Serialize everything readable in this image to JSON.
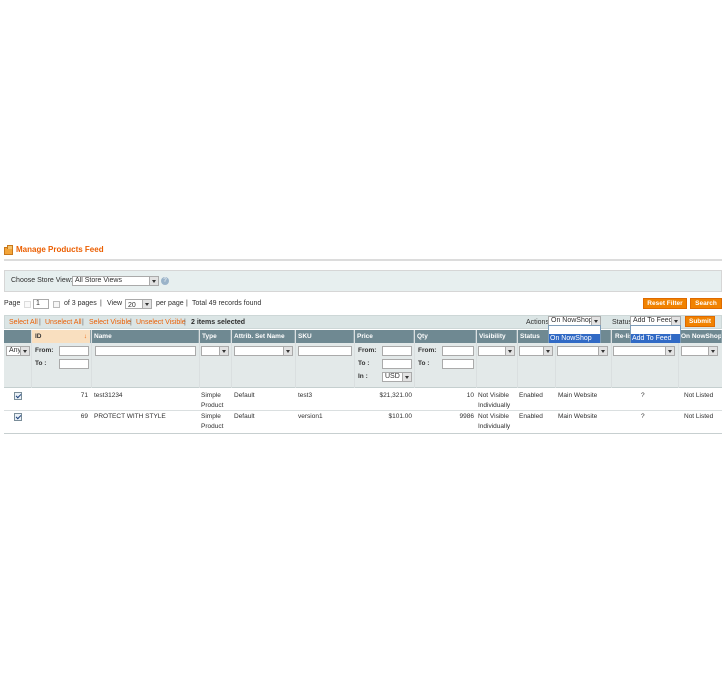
{
  "header": {
    "title": "Manage Products Feed",
    "icon": "box-icon"
  },
  "store": {
    "label": "Choose Store View:",
    "value": "All Store Views"
  },
  "pager": {
    "page_label": "Page",
    "page_value": "1",
    "of_pages": "of 3 pages",
    "sep1": "|",
    "view_label": "View",
    "view_value": "20",
    "per_page": "per page",
    "sep2": "|",
    "total": "Total 49 records found"
  },
  "buttons": {
    "reset": "Reset Filter",
    "search": "Search",
    "submit": "Submit"
  },
  "mass": {
    "select_all": "Select All",
    "unselect_all": "Unselect All",
    "select_visible": "Select Visible",
    "unselect_visible": "Unselect Visible",
    "sep": "|",
    "selected": "2 items selected",
    "actions_label": "Actions",
    "actions_value": "On NowShop",
    "actions_option": "On NowShop",
    "status_label": "Status",
    "status_value": "Add To Feed",
    "status_option": "Add To Feed"
  },
  "columns": {
    "id": "ID",
    "name": "Name",
    "type": "Type",
    "attrib": "Attrib. Set Name",
    "sku": "SKU",
    "price": "Price",
    "qty": "Qty",
    "visibility": "Visibility",
    "status": "Status",
    "relist": "Re-lis",
    "nowshop": "On NowShop"
  },
  "filters": {
    "any": "Any",
    "from": "From:",
    "to": "To :",
    "in": "In :",
    "currency": "USD"
  },
  "rows": [
    {
      "id": "71",
      "name": "test31234",
      "type1": "Simple",
      "type2": "Product",
      "attrib": "Default",
      "sku": "test3",
      "price": "$21,321.00",
      "qty": "10",
      "vis1": "Not Visible",
      "vis2": "Individually",
      "status": "Enabled",
      "website": "Main Website",
      "relist": "?",
      "nowshop": "Not Listed"
    },
    {
      "id": "69",
      "name": "PROTECT WITH STYLE",
      "type1": "Simple",
      "type2": "Product",
      "attrib": "Default",
      "sku": "version1",
      "price": "$101.00",
      "qty": "9986",
      "vis1": "Not Visible",
      "vis2": "Individually",
      "status": "Enabled",
      "website": "Main Website",
      "relist": "?",
      "nowshop": "Not Listed"
    }
  ],
  "colors": {
    "accent": "#eb5e00",
    "button": "#f18200",
    "gridhead": "#6f8992",
    "filterbg": "#e3e9e9"
  }
}
